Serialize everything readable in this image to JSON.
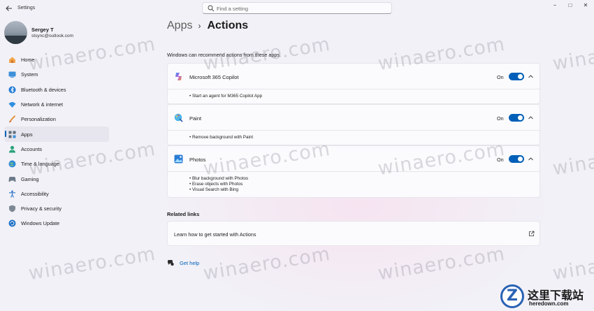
{
  "window": {
    "title": "Settings",
    "search_placeholder": "Find a setting",
    "minimize": "−",
    "maximize": "□",
    "close": "✕"
  },
  "profile": {
    "name": "Sergey T",
    "email": "stsync@outlook.com"
  },
  "nav": {
    "items": [
      {
        "label": "Home",
        "icon": "home-icon",
        "active": false
      },
      {
        "label": "System",
        "icon": "system-icon",
        "active": false
      },
      {
        "label": "Bluetooth & devices",
        "icon": "bluetooth-icon",
        "active": false
      },
      {
        "label": "Network & internet",
        "icon": "network-icon",
        "active": false
      },
      {
        "label": "Personalization",
        "icon": "personalization-icon",
        "active": false
      },
      {
        "label": "Apps",
        "icon": "apps-icon",
        "active": true
      },
      {
        "label": "Accounts",
        "icon": "accounts-icon",
        "active": false
      },
      {
        "label": "Time & language",
        "icon": "time-language-icon",
        "active": false
      },
      {
        "label": "Gaming",
        "icon": "gaming-icon",
        "active": false
      },
      {
        "label": "Accessibility",
        "icon": "accessibility-icon",
        "active": false
      },
      {
        "label": "Privacy & security",
        "icon": "privacy-shield-icon",
        "active": false
      },
      {
        "label": "Windows Update",
        "icon": "windows-update-icon",
        "active": false
      }
    ]
  },
  "main": {
    "breadcrumb_parent": "Apps",
    "breadcrumb_sep": "›",
    "breadcrumb_current": "Actions",
    "intro": "Windows can recommend actions from these apps.",
    "apps": [
      {
        "name": "Microsoft 365 Copilot",
        "icon": "copilot-icon",
        "toggle_label": "On",
        "enabled": true,
        "actions": [
          "• Start an agent for M365 Copilot App"
        ]
      },
      {
        "name": "Paint",
        "icon": "paint-icon",
        "toggle_label": "On",
        "enabled": true,
        "actions": [
          "• Remove background with Paint"
        ]
      },
      {
        "name": "Photos",
        "icon": "photos-icon",
        "toggle_label": "On",
        "enabled": true,
        "actions": [
          "• Blur background with Photos",
          "• Erase objects with Photos",
          "• Visual Search with Bing"
        ]
      }
    ],
    "related_title": "Related links",
    "related_link": "Learn how to get started with Actions",
    "help": "Get help"
  },
  "watermark_text": "winaero.com",
  "logo": {
    "letter": "Z",
    "cn": "这里下载站",
    "en": "heredown.com"
  },
  "colors": {
    "accent": "#005fb8",
    "background": "#f2f1f7",
    "card": "#fbfbfd"
  }
}
